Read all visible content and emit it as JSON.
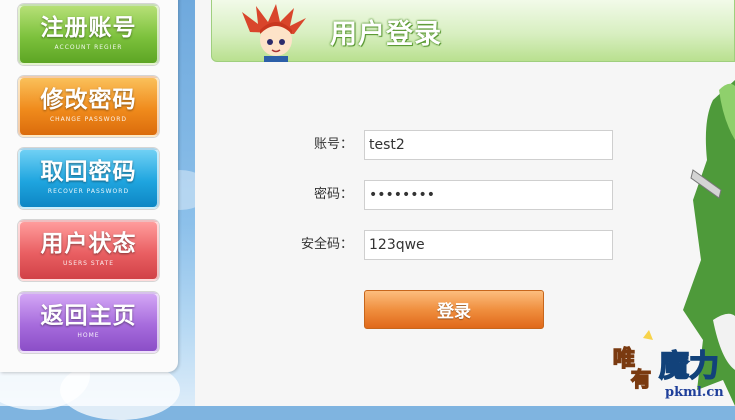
{
  "menu": [
    {
      "label": "注册账号",
      "sub": "ACCOUNT REGIER"
    },
    {
      "label": "修改密码",
      "sub": "CHANGE PASSWORD"
    },
    {
      "label": "取回密码",
      "sub": "RECOVER PASSWORD"
    },
    {
      "label": "用户状态",
      "sub": "USERS STATE"
    },
    {
      "label": "返回主页",
      "sub": "HOME"
    }
  ],
  "header": {
    "title": "用户登录"
  },
  "form": {
    "account_label": "账号：",
    "account_value": "test2",
    "password_label": "密码：",
    "password_value": "••••••••",
    "security_label": "安全码：",
    "security_value": "123qwe",
    "login_label": "登录"
  },
  "logo": {
    "name": "唯有魔力",
    "site": "pkml.cn"
  },
  "colors": {
    "green": "#7cc13c",
    "orange": "#f08b1c",
    "blue": "#1fa5df",
    "red": "#e95f62",
    "purple": "#a66bdc",
    "login": "#f08f3f"
  }
}
